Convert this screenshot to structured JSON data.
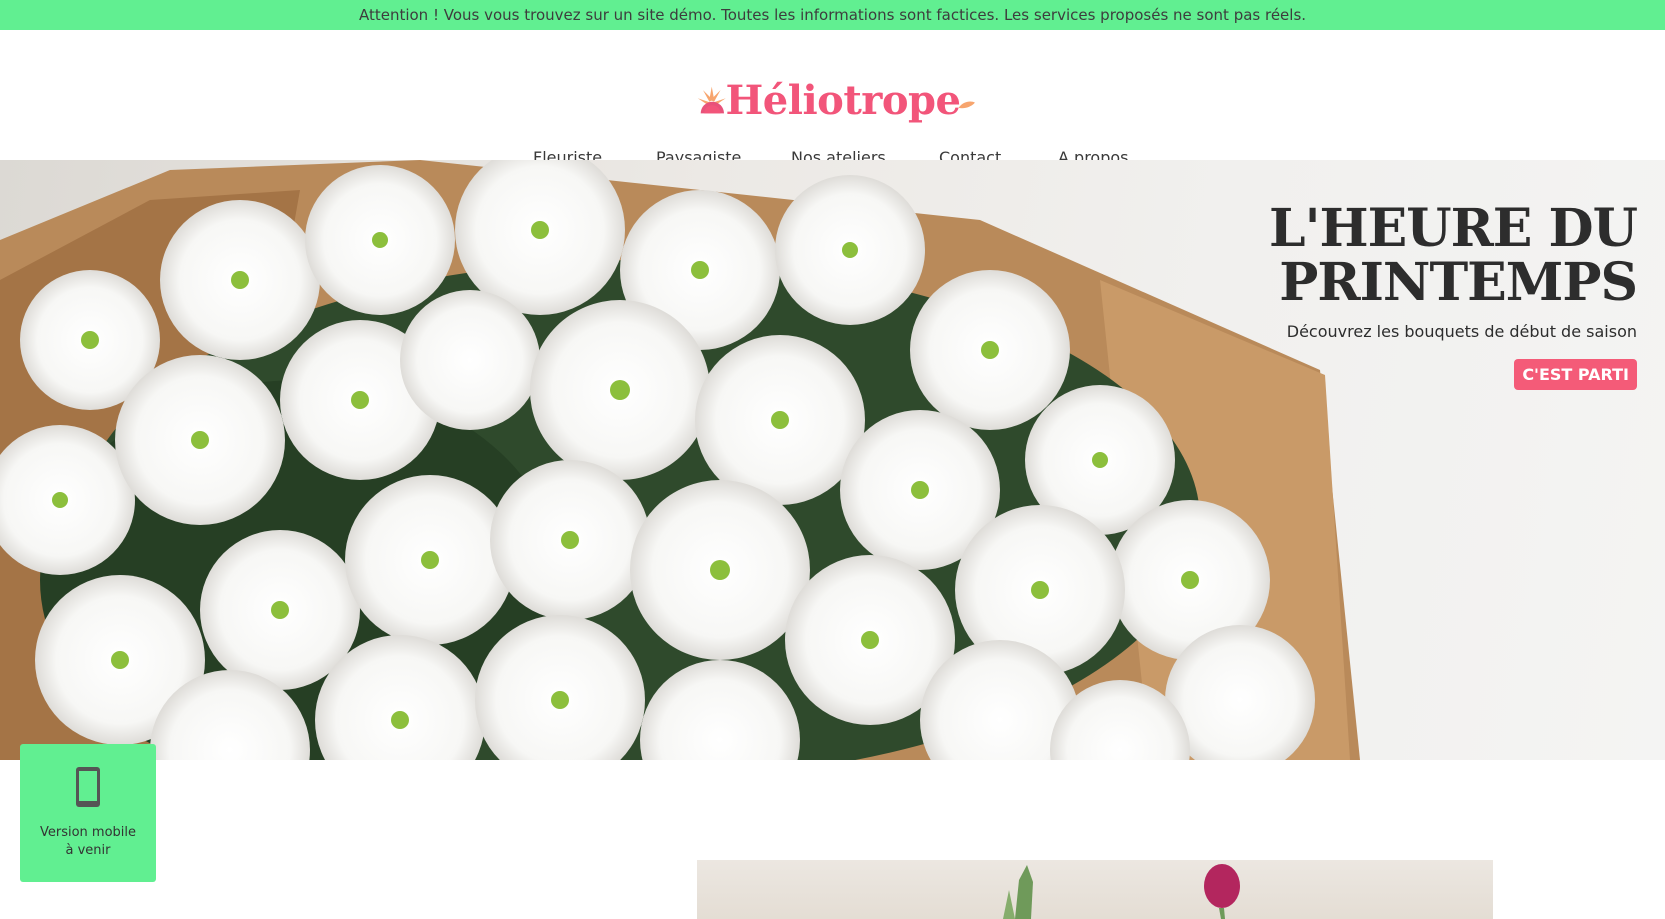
{
  "banner": {
    "text": "Attention ! Vous vous trouvez sur un site démo. Toutes les informations sont factices. Les services proposés ne sont pas réels."
  },
  "header": {
    "logo_text": "Héliotrope"
  },
  "nav": {
    "items": [
      {
        "label": "Fleuriste",
        "active": true
      },
      {
        "label": "Paysagiste",
        "active": false
      },
      {
        "label": "Nos ateliers",
        "active": false
      },
      {
        "label": "Contact",
        "active": false
      },
      {
        "label": "A propos",
        "active": false
      }
    ]
  },
  "hero": {
    "title_line1": "L'HEURE DU",
    "title_line2": "PRINTEMPS",
    "subtitle": "Découvrez les bouquets de début de saison",
    "cta_label": "C'EST PARTI"
  },
  "mobile_badge": {
    "line1": "Version mobile",
    "line2": "à venir",
    "icon": "phone-icon"
  },
  "colors": {
    "accent_green": "#61ef91",
    "brand_pink": "#f2557a",
    "cta_pink": "#f45b78",
    "text_dark": "#2d2d2d"
  }
}
